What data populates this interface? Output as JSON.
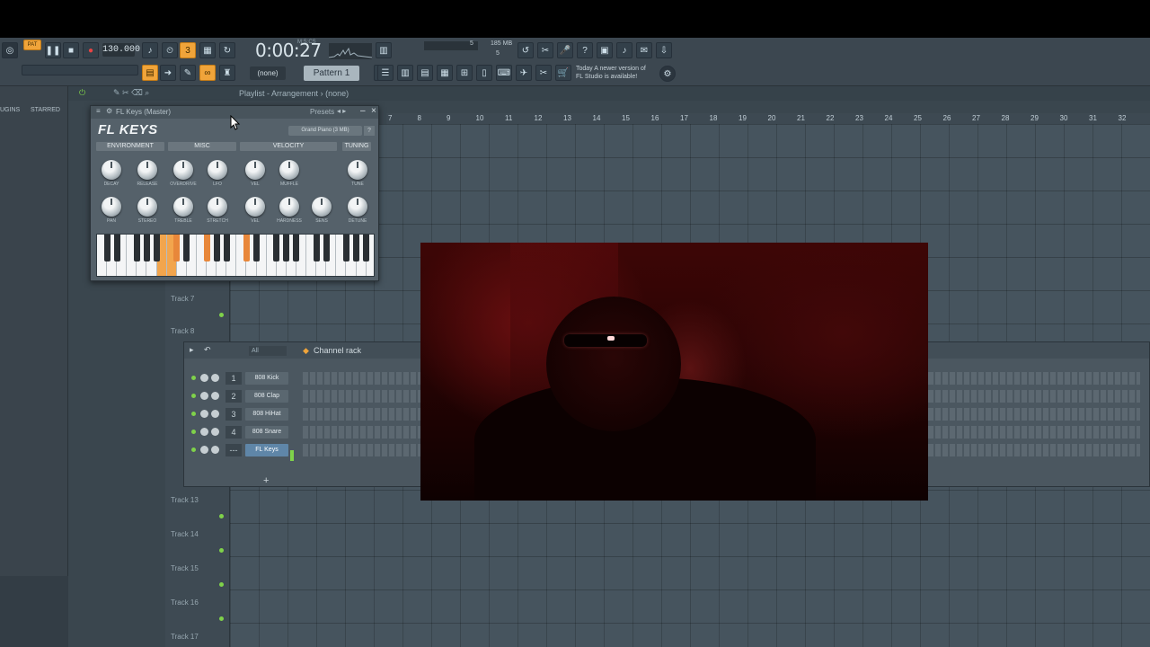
{
  "toolbar": {
    "mode_label": "PAT",
    "tempo": "130.000",
    "time": "0:00:27",
    "time_unit": "M:S:CS",
    "cpu_num": "5",
    "memory": "185 MB",
    "poly": "5",
    "pattern_none": "(none)",
    "pattern_selected": "Pattern 1",
    "news_line1": "Today  A newer version of",
    "news_line2": "FL Studio is available!"
  },
  "browser": {
    "tab_plugins": "UGINS",
    "tab_starred": "STARRED"
  },
  "playlist": {
    "title": "Playlist - Arrangement",
    "title_sep": "›",
    "title_pattern": "(none)",
    "ruler": [
      "7",
      "8",
      "9",
      "10",
      "11",
      "12",
      "13",
      "14",
      "15",
      "16",
      "17",
      "18",
      "19",
      "20",
      "21",
      "22",
      "23",
      "24",
      "25",
      "26",
      "27",
      "28",
      "29",
      "30",
      "31",
      "32"
    ],
    "tracks": [
      "Track 7",
      "Track 8",
      "Track 13",
      "Track 14",
      "Track 15",
      "Track 16",
      "Track 17"
    ]
  },
  "flkeys": {
    "window_title": "FL Keys (Master)",
    "presets_label": "Presets",
    "logo": "FL KEYS",
    "preset": "Grand Piano (3 MB)",
    "help": "?",
    "sections": [
      "ENVIRONMENT",
      "MISC",
      "VELOCITY",
      "TUNING"
    ],
    "knob_labels_row1": [
      "DECAY",
      "RELEASE",
      "OVERDRIVE",
      "LFO",
      "VEL",
      "MUFFLE",
      "TUNE"
    ],
    "knob_labels_row2": [
      "PAN",
      "STEREO",
      "TREBLE",
      "STRETCH",
      "VEL",
      "HARDNESS",
      "SENS",
      "DETUNE"
    ]
  },
  "channel_rack": {
    "filter": "All",
    "title": "Channel rack",
    "channels": [
      {
        "num": "1",
        "name": "808 Kick"
      },
      {
        "num": "2",
        "name": "808 Clap"
      },
      {
        "num": "3",
        "name": "808 HiHat"
      },
      {
        "num": "4",
        "name": "808 Snare"
      },
      {
        "num": "---",
        "name": "FL Keys"
      }
    ],
    "add": "+"
  },
  "colors": {
    "accent_orange": "#f0a43a",
    "led_green": "#7fd24a",
    "selected_channel": "#5f86a8"
  }
}
